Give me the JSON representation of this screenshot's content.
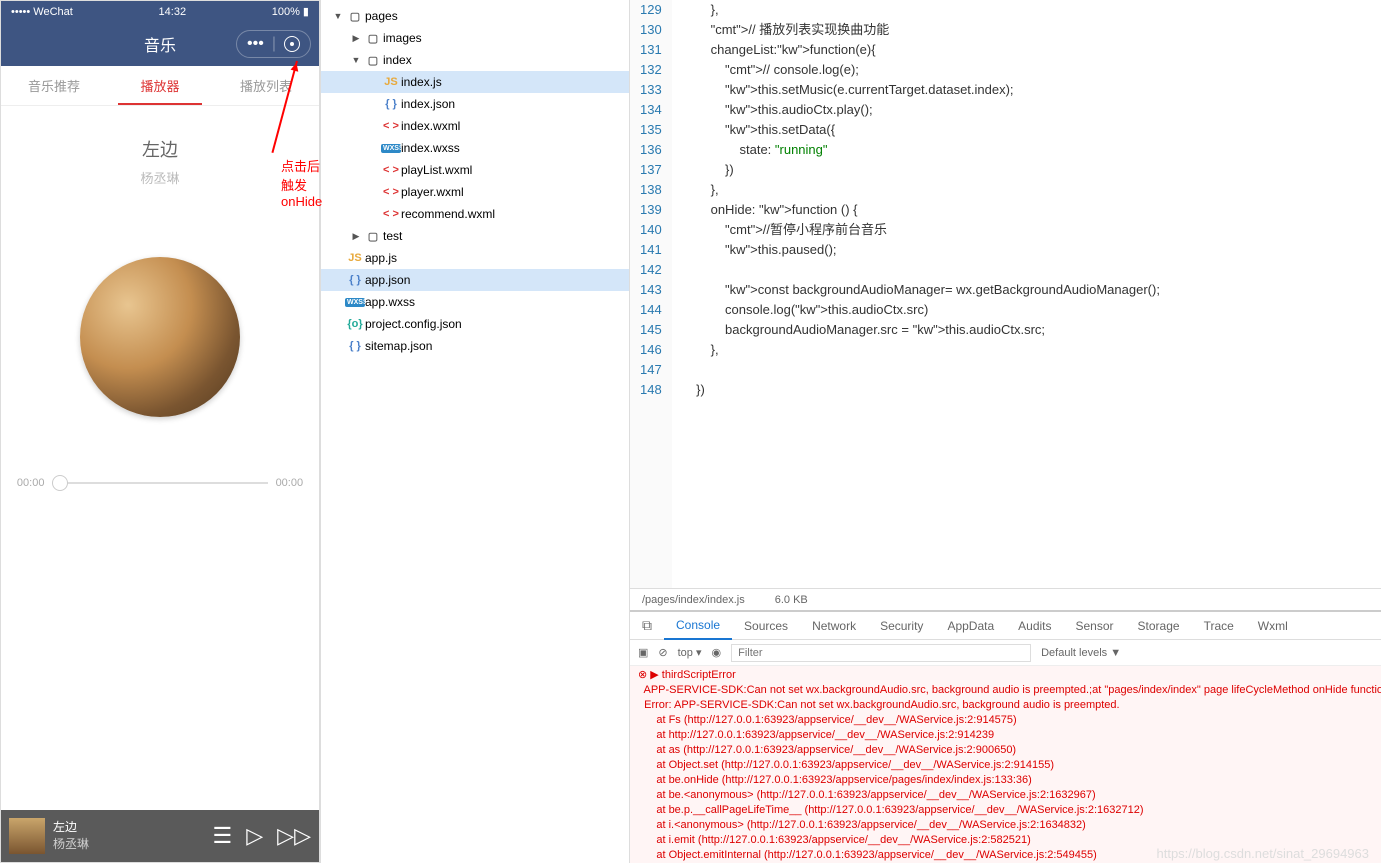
{
  "simulator": {
    "status": {
      "carrier": "••••• WeChat",
      "wifi": "⚲",
      "time": "14:32",
      "battery": "100%"
    },
    "navbar": {
      "title": "音乐"
    },
    "tabs": [
      "音乐推荐",
      "播放器",
      "播放列表"
    ],
    "activeTab": 1,
    "song": {
      "title": "左边",
      "artist": "杨丞琳"
    },
    "progress": {
      "current": "00:00",
      "total": "00:00"
    },
    "mini": {
      "title": "左边",
      "artist": "杨丞琳"
    }
  },
  "annotation": {
    "line1": "点击后触发",
    "line2": "onHide"
  },
  "tree": [
    {
      "d": 0,
      "t": "▼",
      "ic": "folder",
      "label": "pages"
    },
    {
      "d": 1,
      "t": "▶",
      "ic": "folder",
      "label": "images"
    },
    {
      "d": 1,
      "t": "▼",
      "ic": "folder",
      "label": "index"
    },
    {
      "d": 2,
      "t": "",
      "ic": "js",
      "label": "index.js",
      "sel": true
    },
    {
      "d": 2,
      "t": "",
      "ic": "json",
      "label": "index.json"
    },
    {
      "d": 2,
      "t": "",
      "ic": "wxml",
      "label": "index.wxml"
    },
    {
      "d": 2,
      "t": "",
      "ic": "wxss",
      "label": "index.wxss"
    },
    {
      "d": 2,
      "t": "",
      "ic": "wxml",
      "label": "playList.wxml"
    },
    {
      "d": 2,
      "t": "",
      "ic": "wxml",
      "label": "player.wxml"
    },
    {
      "d": 2,
      "t": "",
      "ic": "wxml",
      "label": "recommend.wxml"
    },
    {
      "d": 1,
      "t": "▶",
      "ic": "folder",
      "label": "test"
    },
    {
      "d": 0,
      "t": "",
      "ic": "js",
      "label": "app.js"
    },
    {
      "d": 0,
      "t": "",
      "ic": "json",
      "label": "app.json",
      "sel2": true
    },
    {
      "d": 0,
      "t": "",
      "ic": "wxss",
      "label": "app.wxss"
    },
    {
      "d": 0,
      "t": "",
      "ic": "config",
      "label": "project.config.json"
    },
    {
      "d": 0,
      "t": "",
      "ic": "json",
      "label": "sitemap.json"
    }
  ],
  "editor": {
    "startLine": 129,
    "lines": [
      "        },",
      "        // 播放列表实现换曲功能",
      "        changeList:function(e){",
      "            // console.log(e);",
      "            this.setMusic(e.currentTarget.dataset.index);",
      "            this.audioCtx.play();",
      "            this.setData({",
      "                state: \"running\"",
      "            })",
      "        },",
      "        onHide: function () {",
      "            //暂停小程序前台音乐",
      "            this.paused();",
      "",
      "            const backgroundAudioManager= wx.getBackgroundAudioManager();",
      "            console.log(this.audioCtx.src)",
      "            backgroundAudioManager.src = this.audioCtx.src;",
      "        },",
      "",
      "    })"
    ],
    "path": "/pages/index/index.js",
    "size": "6.0 KB"
  },
  "devtools": {
    "tabs": [
      "Console",
      "Sources",
      "Network",
      "Security",
      "AppData",
      "Audits",
      "Sensor",
      "Storage",
      "Trace",
      "Wxml"
    ],
    "activeTab": 0,
    "context": "top",
    "filterPlaceholder": "Filter",
    "levels": "Default levels ▼",
    "console": [
      "▶ thirdScriptError",
      "  APP-SERVICE-SDK:Can not set wx.backgroundAudio.src, background audio is preempted.;at \"pages/index/index\" page lifeCycleMethod onHide function",
      "  Error: APP-SERVICE-SDK:Can not set wx.backgroundAudio.src, background audio is preempted.",
      "      at Fs (http://127.0.0.1:63923/appservice/__dev__/WAService.js:2:914575)",
      "      at http://127.0.0.1:63923/appservice/__dev__/WAService.js:2:914239",
      "      at as (http://127.0.0.1:63923/appservice/__dev__/WAService.js:2:900650)",
      "      at Object.set (http://127.0.0.1:63923/appservice/__dev__/WAService.js:2:914155)",
      "      at be.onHide (http://127.0.0.1:63923/appservice/pages/index/index.js:133:36)",
      "      at be.<anonymous> (http://127.0.0.1:63923/appservice/__dev__/WAService.js:2:1632967)",
      "      at be.p.__callPageLifeTime__ (http://127.0.0.1:63923/appservice/__dev__/WAService.js:2:1632712)",
      "      at i.<anonymous> (http://127.0.0.1:63923/appservice/__dev__/WAService.js:2:1634832)",
      "      at i.emit (http://127.0.0.1:63923/appservice/__dev__/WAService.js:2:582521)",
      "      at Object.emitInternal (http://127.0.0.1:63923/appservice/__dev__/WAService.js:2:549455)"
    ]
  },
  "watermark": "https://blog.csdn.net/sinat_29694963"
}
